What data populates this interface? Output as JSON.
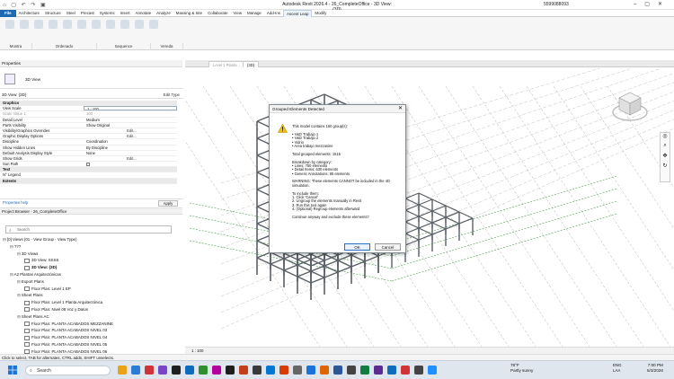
{
  "window": {
    "title": "Autodesk Revit 2026.4 - 26_CompleteOffice - 3D View: {3D}",
    "user": "5599088093"
  },
  "ribbon": {
    "tabs": [
      "File",
      "Architecture",
      "Structure",
      "Steel",
      "Precast",
      "Systems",
      "Insert",
      "Annotate",
      "Analyze",
      "Massing & Site",
      "Collaborate",
      "View",
      "Manage",
      "Add-Ins",
      "Ascent Leap",
      "Modify"
    ],
    "active_tab": "Ascent Leap",
    "panels": [
      "Mostra",
      "Ordenado",
      "Sequence",
      "Vereda"
    ]
  },
  "properties": {
    "title": "Properties",
    "type_name": "3D View",
    "selector": "3D View: {3D}",
    "edit_type": "Edit Type",
    "help": "Properties help",
    "apply": "Apply",
    "rows": [
      {
        "k": "Graphics",
        "group": true
      },
      {
        "k": "View Scale",
        "v": "1 : 100",
        "style": "box"
      },
      {
        "k": "Scale Value    1:",
        "v": "100",
        "style": "dim"
      },
      {
        "k": "Detail Level",
        "v": "Medium"
      },
      {
        "k": "Parts Visibility",
        "v": "Show Original"
      },
      {
        "k": "Visibility/Graphics Overrides",
        "v": "Edit...",
        "style": "btn"
      },
      {
        "k": "Graphic Display Options",
        "v": "Edit...",
        "style": "btn"
      },
      {
        "k": "Discipline",
        "v": "Coordination"
      },
      {
        "k": "Show Hidden Lines",
        "v": "By Discipline"
      },
      {
        "k": "Default Analysis Display Style",
        "v": "None"
      },
      {
        "k": "Show Grids",
        "v": "Edit...",
        "style": "btn"
      },
      {
        "k": "Sun Path",
        "v": ""
      },
      {
        "k": "Text",
        "group": true
      },
      {
        "k": "N° Legend",
        "v": ""
      },
      {
        "k": "Extents",
        "group": true
      }
    ]
  },
  "browser": {
    "title": "Project Browser - 26_CompleteOffice",
    "search_placeholder": "Search",
    "tree": [
      {
        "t": "[0] Views (01 - View Group - View Type)",
        "lvl": 0
      },
      {
        "t": "???",
        "lvl": 1
      },
      {
        "t": "3D Views",
        "lvl": 2
      },
      {
        "t": "3D View: SSSS",
        "lvl": 3,
        "pg": true
      },
      {
        "t": "3D View: {3D}",
        "lvl": 3,
        "pg": true,
        "bold": true
      },
      {
        "t": "A2 Plantas Arquitectónicas",
        "lvl": 1
      },
      {
        "t": "Export Plans",
        "lvl": 2
      },
      {
        "t": "Floor Plan: Level 1 EP",
        "lvl": 3,
        "pg": true
      },
      {
        "t": "Sheet Plans",
        "lvl": 2
      },
      {
        "t": "Floor Plan: Level 1 Planta Arquitectónica",
        "lvl": 3,
        "pg": true
      },
      {
        "t": "Floor Plan: Nivel 08 Voz y Datos",
        "lvl": 3,
        "pg": true
      },
      {
        "t": "Sheet Plans AC",
        "lvl": 2
      },
      {
        "t": "Floor Plan: PLANTA ACABADOS MEZZANINE",
        "lvl": 3,
        "pg": true
      },
      {
        "t": "Floor Plan: PLANTA ACABADOS NIVEL 03",
        "lvl": 3,
        "pg": true
      },
      {
        "t": "Floor Plan: PLANTA ACABADOS NIVEL 04",
        "lvl": 3,
        "pg": true
      },
      {
        "t": "Floor Plan: PLANTA ACABADOS NIVEL 05",
        "lvl": 3,
        "pg": true
      },
      {
        "t": "Floor Plan: PLANTA ACABADOS NIVEL 06",
        "lvl": 3,
        "pg": true
      },
      {
        "t": "Floor Plan: PLANTA ACABADOS NIVEL 07",
        "lvl": 3,
        "pg": true
      },
      {
        "t": "Floor Plan: PLANTA ACABADOS NIVEL 08",
        "lvl": 3,
        "pg": true
      }
    ]
  },
  "views": {
    "tabs": [
      "Level 1 Planta ...",
      "{3D}"
    ],
    "scale": "1 : 100"
  },
  "dialog": {
    "title": "Grouped Elements Detected",
    "lines": [
      "This model contains 160 group(s):",
      "",
      "• V&D Trabajo 1",
      "• V&D Trabajo 2",
      "• Vidrio",
      "• Area trabajo mezzanine",
      "",
      "Total grouped elements: 1515",
      "",
      "Breakdown by category:",
      "• Lines: 750 elements",
      "• Detail Items: 630 elements",
      "• Generic Annotations: 95 elements",
      "",
      "WARNING: These elements CANNOT be included in the 4D",
      "simulation.",
      "",
      "To include them:",
      "1. Click 'Cancel'",
      "2. Ungroup the elements manually in Revit",
      "3. Run this tool again",
      "4. (Optional) Regroup elements afterward",
      "",
      "Continue anyway and exclude these elements?"
    ],
    "ok": "OK",
    "cancel": "Cancel"
  },
  "status": {
    "text": "Click to select, TAB for alternates, CTRL adds, SHIFT unselects."
  },
  "taskbar": {
    "search": "Search",
    "weather_temp": "78°F",
    "weather_desc": "Partly sunny",
    "lang1": "ENG",
    "lang2": "LAA",
    "time": "7:00 PM",
    "date": "5/3/2026"
  },
  "colors": {
    "file_tab": "#1d69b4",
    "structure": "#5a6066",
    "grid_green": "#2e8b2e"
  }
}
